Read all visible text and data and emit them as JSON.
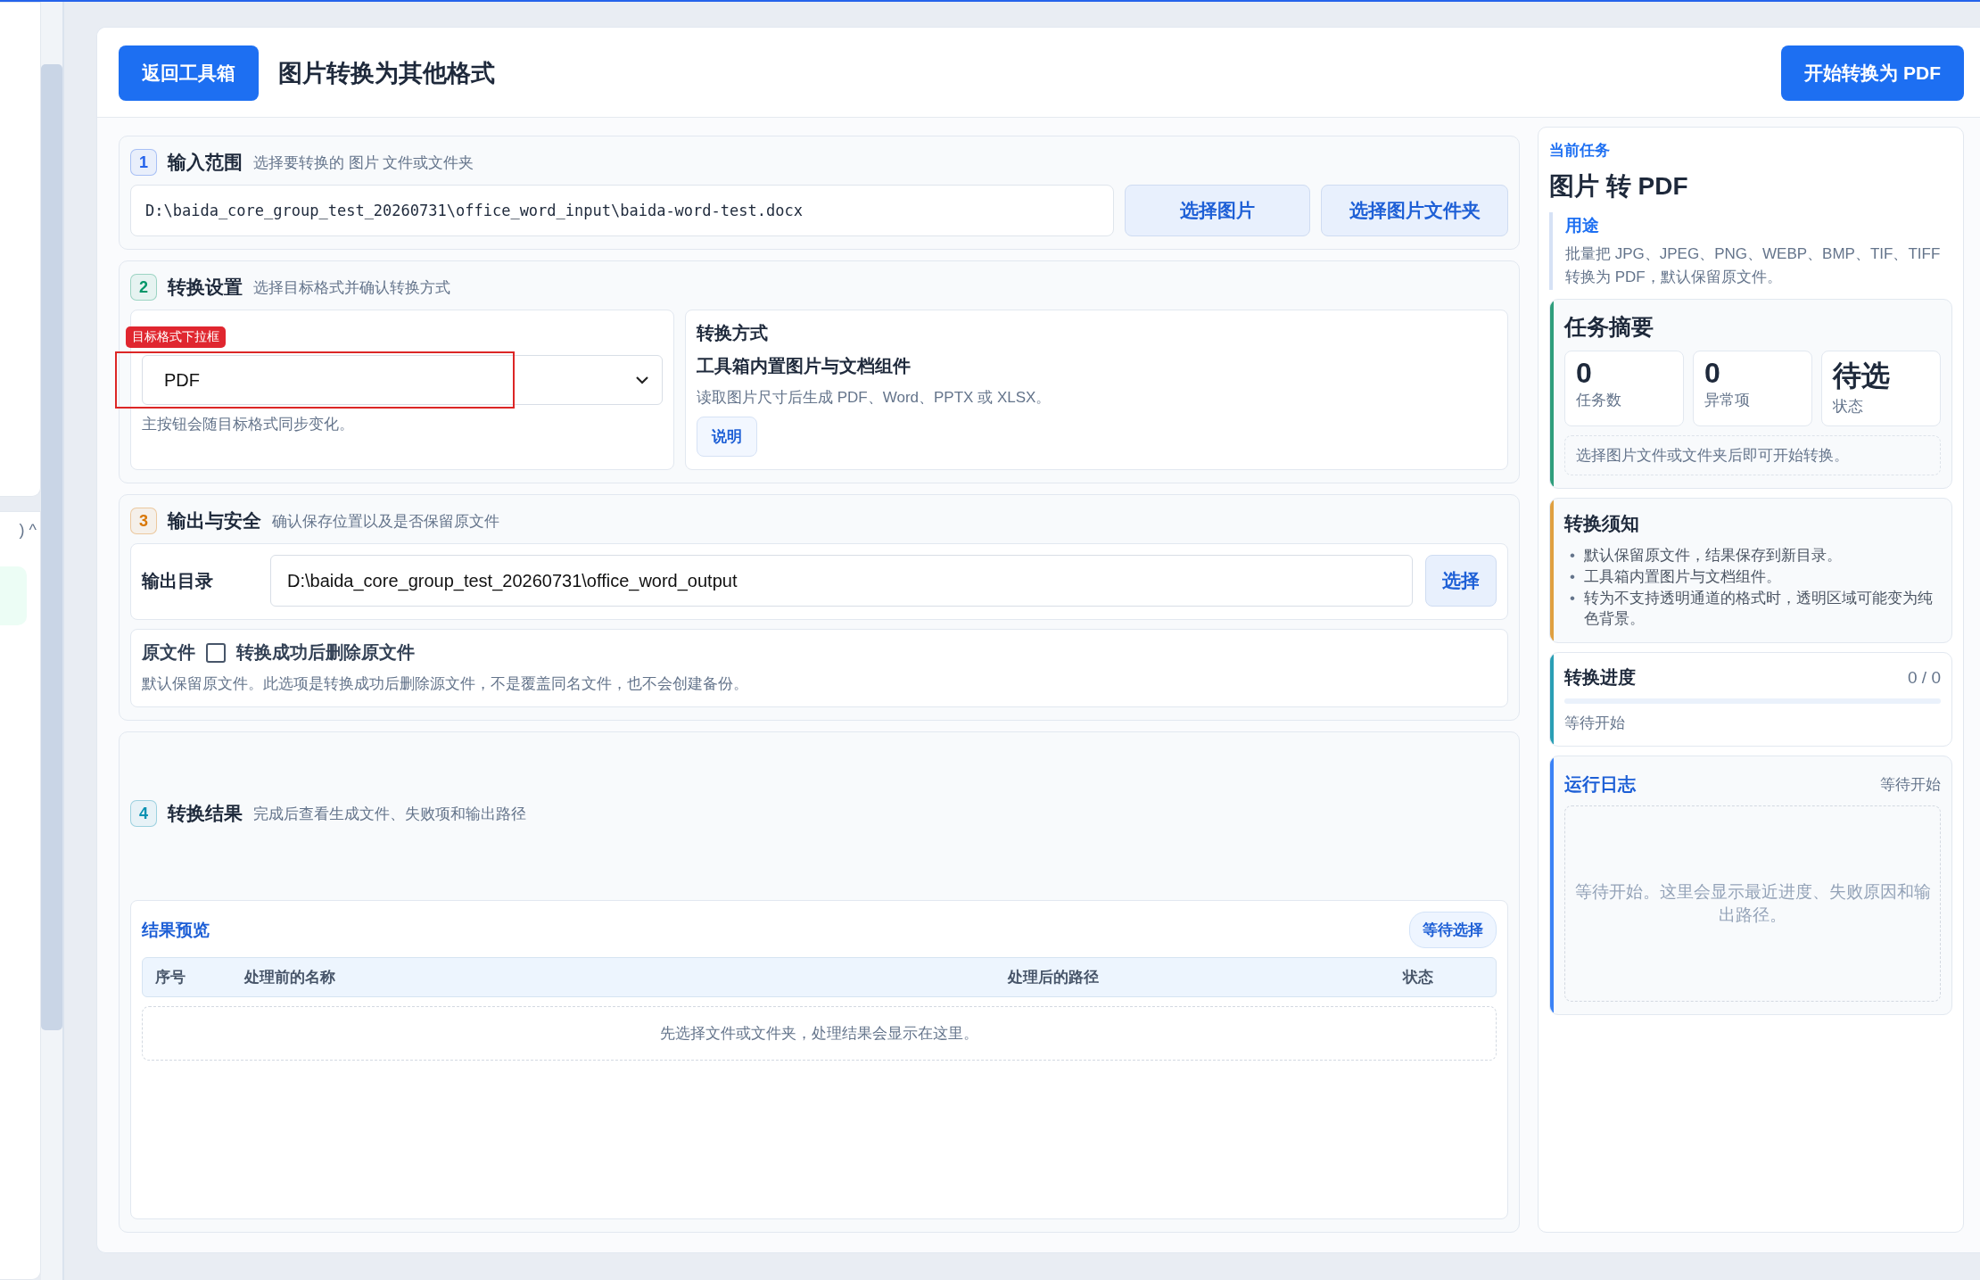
{
  "sidebar": {
    "caret": ") ^"
  },
  "header": {
    "back_button": "返回工具箱",
    "title": "图片转换为其他格式",
    "primary_button": "开始转换为 PDF"
  },
  "sections": [
    {
      "step": "1",
      "color": "#2563eb",
      "title": "输入范围",
      "hint": "选择要转换的 图片 文件或文件夹",
      "kind": "input",
      "path": "D:\\baida_core_group_test_20260731\\office_word_input\\baida-word-test.docx",
      "buttons": [
        "选择图片",
        "选择图片文件夹"
      ]
    },
    {
      "step": "2",
      "color": "#059669",
      "title": "转换设置",
      "hint": "选择目标格式并确认转换方式",
      "kind": "settings",
      "annotation": "目标格式下拉框",
      "format": "PDF",
      "format_note": "主按钮会随目标格式同步变化。",
      "method_title": "转换方式",
      "method_name": "工具箱内置图片与文档组件",
      "method_desc": "读取图片尺寸后生成 PDF、Word、PPTX 或 XLSX。",
      "method_button": "说明"
    },
    {
      "step": "3",
      "color": "#d97706",
      "title": "输出与安全",
      "hint": "确认保存位置以及是否保留原文件",
      "kind": "output",
      "dir_label": "输出目录",
      "dir": "D:\\baida_core_group_test_20260731\\office_word_output",
      "choose": "选择",
      "orig_label": "原文件",
      "delete_label": "转换成功后删除原文件",
      "checked": false,
      "note": "默认保留原文件。此选项是转换成功后删除源文件，不是覆盖同名文件，也不会创建备份。"
    },
    {
      "step": "4",
      "color": "#0891b2",
      "title": "转换结果",
      "hint": "完成后查看生成文件、失败项和输出路径",
      "kind": "results",
      "preview_title": "结果预览",
      "badge": "等待选择",
      "columns": [
        "序号",
        "处理前的名称",
        "处理后的路径",
        "状态"
      ],
      "empty": "先选择文件或文件夹，处理结果会显示在这里。"
    }
  ],
  "side": {
    "eyebrow": "当前任务",
    "title": "图片 转 PDF",
    "use_label": "用途",
    "use_text": "批量把 JPG、JPEG、PNG、WEBP、BMP、TIF、TIFF 转换为 PDF，默认保留原文件。",
    "summary": {
      "title": "任务摘要",
      "color": "#2f9e7c",
      "stats": [
        {
          "value": "0",
          "label": "任务数"
        },
        {
          "value": "0",
          "label": "异常项"
        },
        {
          "value": "待选",
          "label": "状态"
        }
      ],
      "note": "选择图片文件或文件夹后即可开始转换。"
    },
    "notice": {
      "title": "转换须知",
      "color": "#e0a040",
      "bullet": "•",
      "items": [
        "默认保留原文件，结果保存到新目录。",
        "工具箱内置图片与文档组件。",
        "转为不支持透明通道的格式时，透明区域可能变为纯色背景。"
      ]
    },
    "progress": {
      "title": "转换进度",
      "count": "0 / 0",
      "level": 0,
      "status": "等待开始",
      "color": "#2a9fb5"
    },
    "log": {
      "title": "运行日志",
      "status": "等待开始",
      "empty": "等待开始。这里会显示最近进度、失败原因和输出路径。",
      "color": "#3b82f6"
    }
  }
}
